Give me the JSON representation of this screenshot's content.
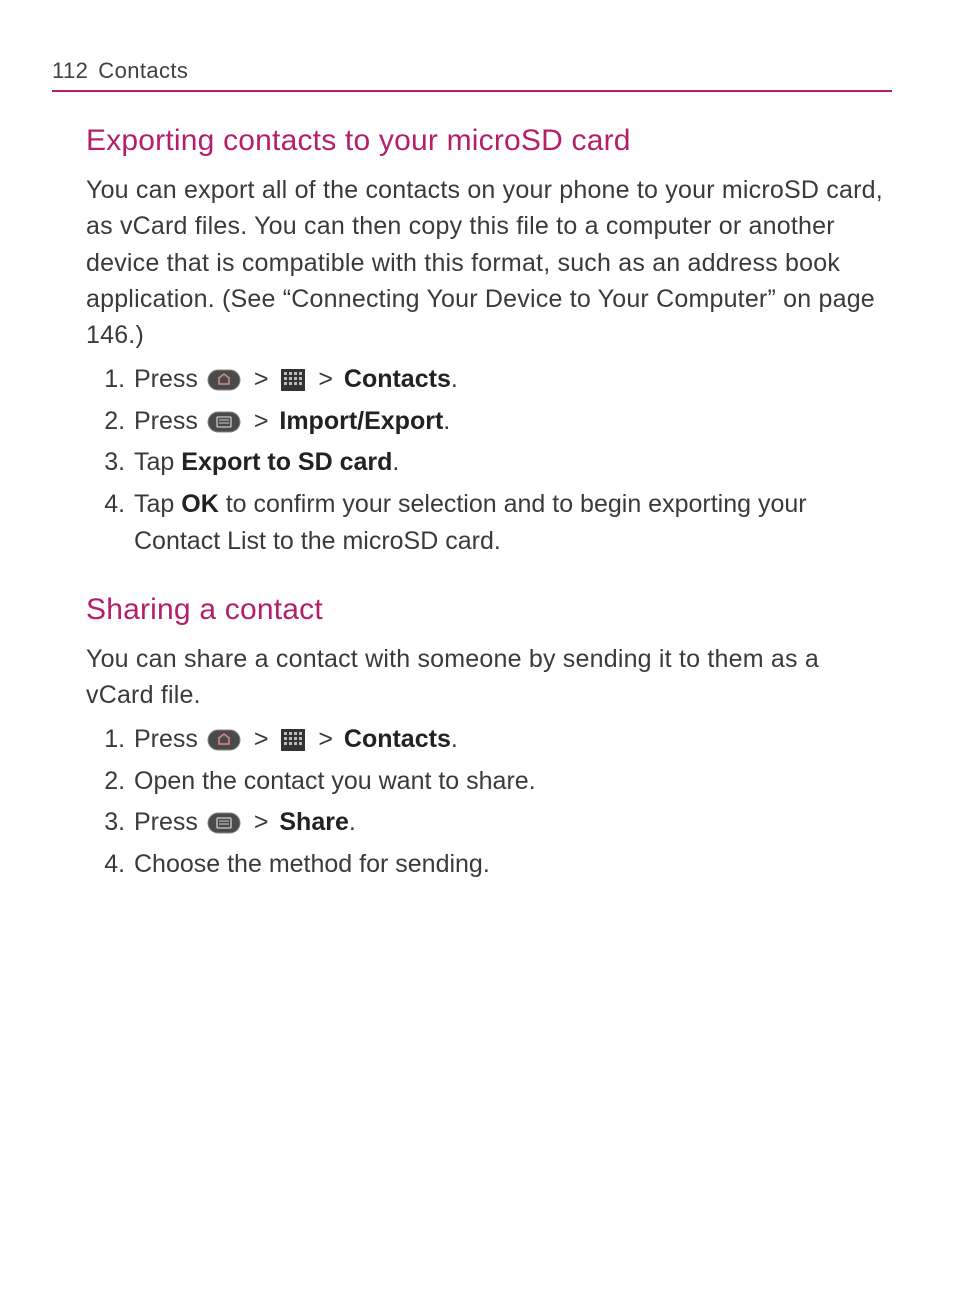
{
  "header": {
    "page_number": "112",
    "chapter": "Contacts"
  },
  "section1": {
    "title": "Exporting contacts to your microSD card",
    "intro": "You can export all of the contacts on your phone to your microSD card, as vCard files. You can then copy this file to a computer or another device that is compatible with this format, such as an address book application. (See “Connecting Your Device to Your Computer” on page 146.)",
    "steps": {
      "s1_press": "Press ",
      "s1_contacts": "Contacts",
      "s1_end": ".",
      "s2_press": "Press ",
      "s2_label": "Import/Export",
      "s2_end": ".",
      "s3_tap": "Tap ",
      "s3_label": "Export to SD card",
      "s3_end": ".",
      "s4_tap": "Tap ",
      "s4_ok": "OK",
      "s4_rest": " to confirm your selection and to begin exporting your Contact List to the microSD card."
    }
  },
  "section2": {
    "title": "Sharing a contact",
    "intro": "You can share a contact with someone by sending it to them as a vCard file.",
    "steps": {
      "s1_press": "Press ",
      "s1_contacts": "Contacts",
      "s1_end": ".",
      "s2": "Open the contact you want to share.",
      "s3_press": "Press ",
      "s3_label": "Share",
      "s3_end": ".",
      "s4": "Choose the method for sending."
    }
  },
  "glyphs": {
    "gt": ">"
  }
}
